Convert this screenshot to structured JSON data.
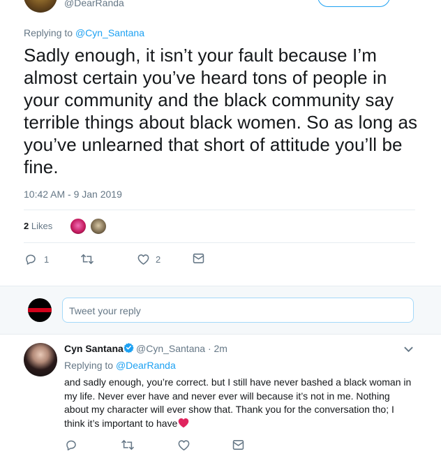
{
  "top_tweet": {
    "author_handle": "@DearRanda",
    "replying_prefix": "Replying to",
    "replying_to": "@Cyn_Santana",
    "text": "Sadly enough, it isn’t your fault because I’m almost certain you’ve heard tons of people in your community and the black community say terrible things about black women. So as long as you’ve unlearned that short of attitude you’ll be fine.",
    "timestamp": "10:42 AM - 9 Jan 2019",
    "likes_count": "2",
    "likes_label": "Likes",
    "actions": {
      "reply_count": "1",
      "retweet_count": "",
      "like_count": "2"
    }
  },
  "reply_composer": {
    "placeholder": "Tweet your reply"
  },
  "reply_tweet": {
    "author_name": "Cyn Santana",
    "author_handle": "@Cyn_Santana",
    "time": "· 2m",
    "replying_prefix": "Replying to",
    "replying_to": "@DearRanda",
    "text": "and sadly enough, you’re correct. but I still have never bashed a black woman in my life. Never ever have and never ever will because it’s not in me. Nothing about my character will ever show that. Thank you for the conversation tho; I think it’s important to have",
    "emoji": "heart-emoji"
  },
  "colors": {
    "accent": "#1da1f2",
    "muted": "#657786",
    "text": "#14171a",
    "band": "#f5f8fa",
    "heart": "#e0245e"
  }
}
